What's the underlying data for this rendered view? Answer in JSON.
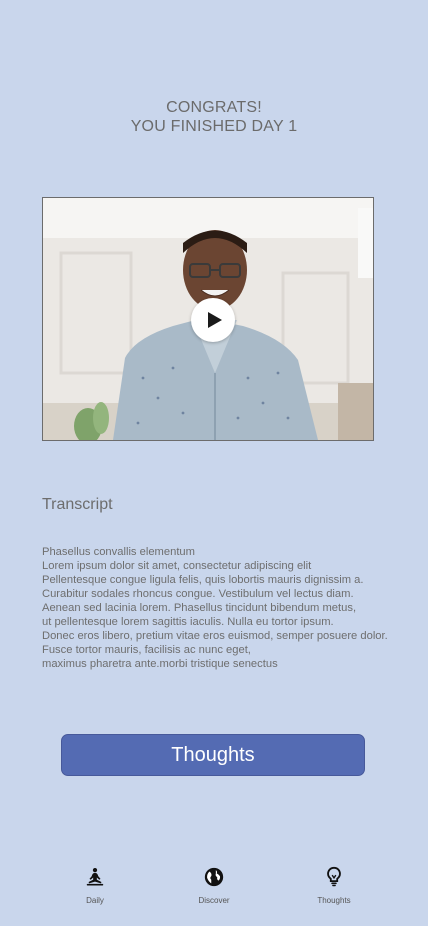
{
  "header": {
    "line1": "CONGRATS!",
    "line2": "YOU FINISHED DAY 1"
  },
  "video": {
    "play_icon": "play-icon"
  },
  "transcript": {
    "title": "Transcript",
    "lines": [
      "Phasellus convallis elementum",
      "Lorem ipsum dolor sit amet, consectetur adipiscing elit",
      "Pellentesque congue ligula felis, quis lobortis mauris dignissim a.",
      "Curabitur sodales rhoncus congue. Vestibulum vel lectus diam.",
      "Aenean sed lacinia lorem. Phasellus tincidunt bibendum metus,",
      "ut pellentesque lorem sagittis iaculis. Nulla eu tortor ipsum.",
      "Donec eros libero, pretium vitae eros euismod, semper posuere dolor.",
      "Fusce tortor mauris, facilisis ac nunc eget,",
      "maximus pharetra ante.morbi tristique senectus"
    ]
  },
  "actions": {
    "thoughts_label": "Thoughts"
  },
  "nav": {
    "items": [
      {
        "label": "Daily",
        "icon": "meditation-icon"
      },
      {
        "label": "Discover",
        "icon": "globe-icon"
      },
      {
        "label": "Thoughts",
        "icon": "lightbulb-icon"
      }
    ]
  },
  "colors": {
    "background": "#c9d6ec",
    "primary_button": "#546bb3"
  }
}
